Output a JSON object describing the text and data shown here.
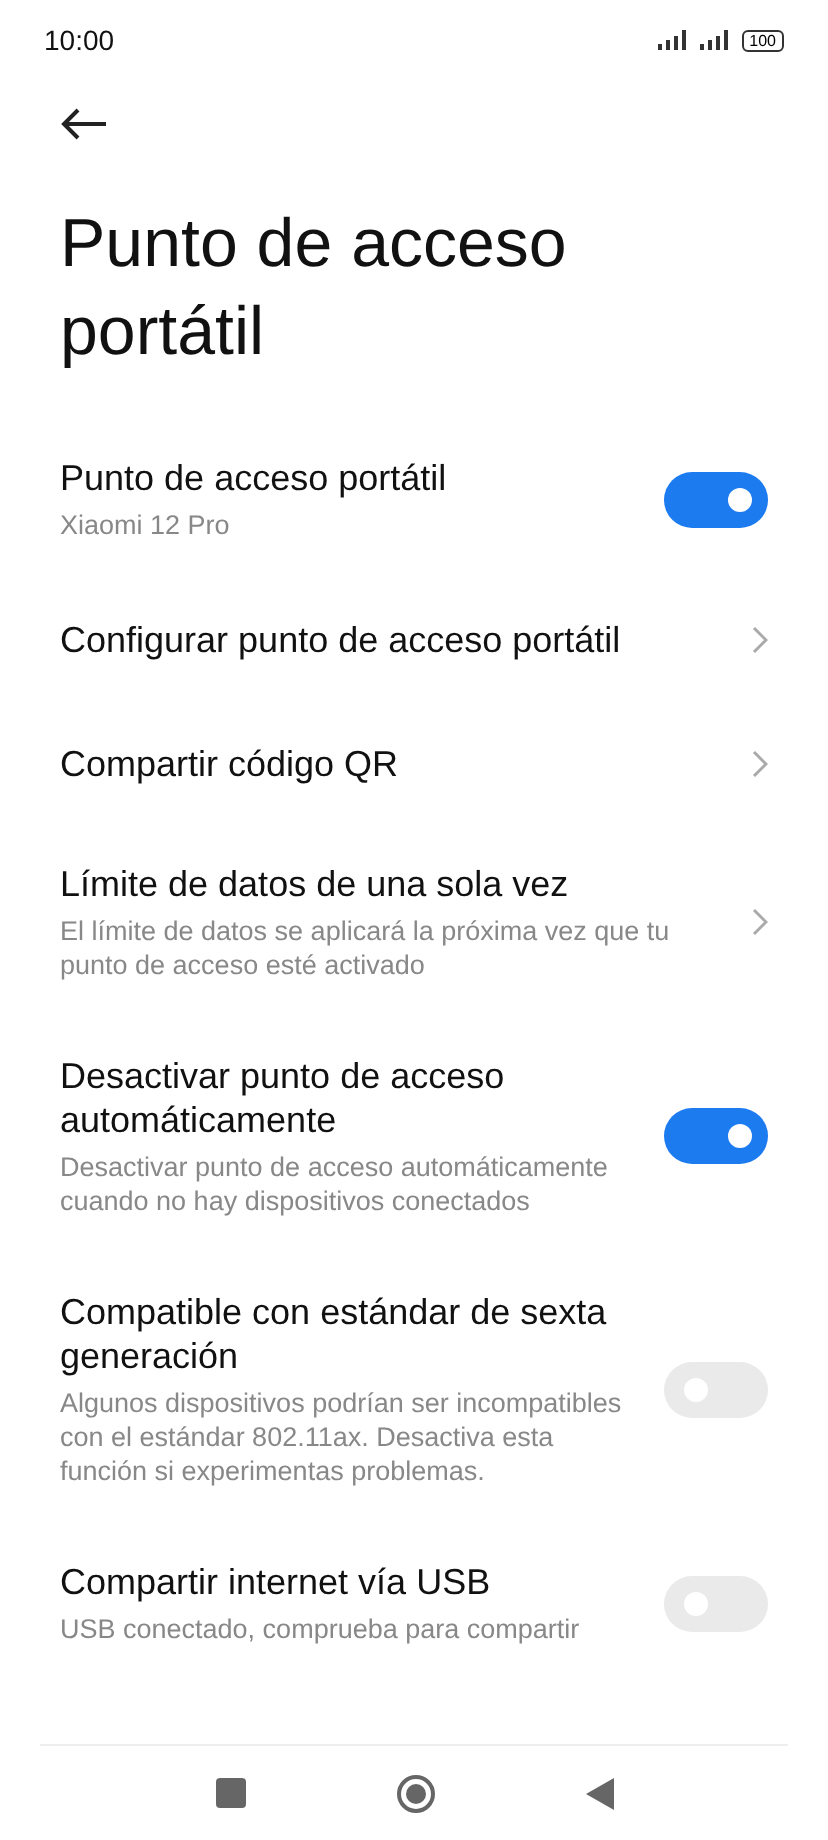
{
  "status_bar": {
    "time": "10:00",
    "battery": "100"
  },
  "title": "Punto de acceso portátil",
  "items": [
    {
      "kind": "toggle",
      "title": "Punto de acceso portátil",
      "subtitle": "Xiaomi 12 Pro",
      "on": true
    },
    {
      "kind": "link",
      "title": "Configurar punto de acceso portátil"
    },
    {
      "kind": "link",
      "title": "Compartir código QR"
    },
    {
      "kind": "link",
      "title": "Límite de datos de una sola vez",
      "subtitle": "El límite de datos se aplicará la próxima vez que tu punto de acceso esté activado"
    },
    {
      "kind": "toggle",
      "title": "Desactivar punto de acceso automáticamente",
      "subtitle": "Desactivar punto de acceso automáticamente cuando no hay dispositivos conectados",
      "on": true
    },
    {
      "kind": "toggle",
      "title": "Compatible con estándar de sexta generación",
      "subtitle": "Algunos dispositivos podrían ser incompatibles con el estándar 802.11ax. Desactiva esta función si experimentas problemas.",
      "on": false
    },
    {
      "kind": "toggle",
      "title": "Compartir internet vía USB",
      "subtitle": "USB conectado, comprueba para compartir",
      "on": false
    }
  ]
}
